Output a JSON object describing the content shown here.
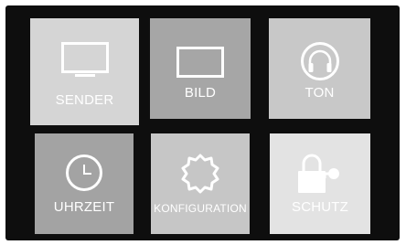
{
  "menu": {
    "tiles": [
      {
        "label": "SENDER",
        "icon": "tv-icon"
      },
      {
        "label": "BILD",
        "icon": "picture-frame-icon"
      },
      {
        "label": "TON",
        "icon": "headphones-icon"
      },
      {
        "label": "UHRZEIT",
        "icon": "clock-icon"
      },
      {
        "label": "KONFIGURATION",
        "icon": "gear-icon"
      },
      {
        "label": "SCHUTZ",
        "icon": "lock-key-icon"
      }
    ]
  },
  "colors": {
    "screen_bg": "#0e0e0e",
    "sender_tile": "#d5d5d5",
    "bild_tile": "#a6a6a6",
    "ton_tile": "#c8c8c8",
    "uhrzeit_tile": "#a3a3a3",
    "konfiguration_tile": "#c6c6c6",
    "schutz_tile": "#e3e3e3",
    "foreground": "#ffffff"
  }
}
